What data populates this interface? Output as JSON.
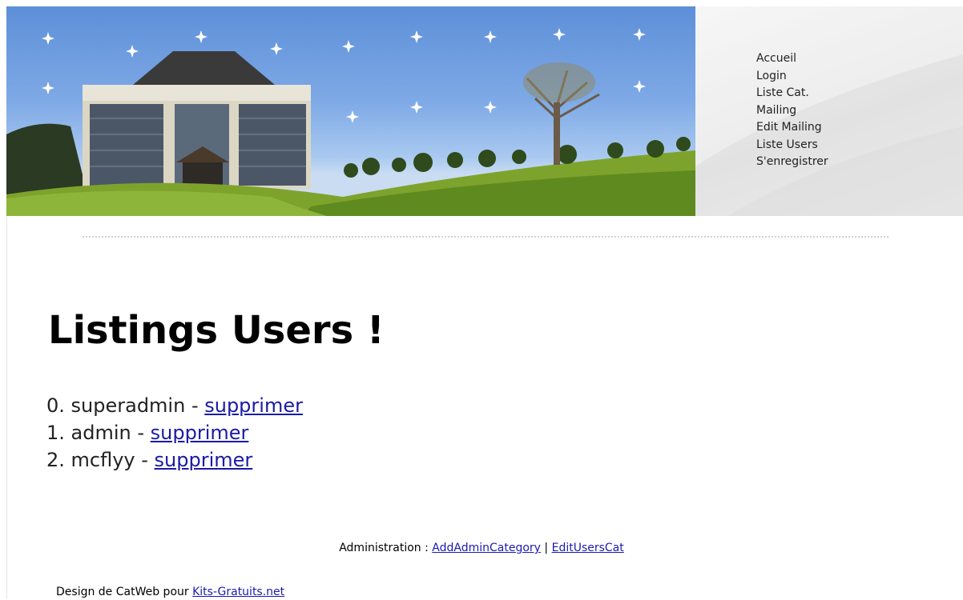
{
  "nav": {
    "items": [
      {
        "label": "Accueil"
      },
      {
        "label": "Login"
      },
      {
        "label": "Liste Cat."
      },
      {
        "label": "Mailing"
      },
      {
        "label": "Edit Mailing"
      },
      {
        "label": "Liste Users"
      },
      {
        "label": "S'enregistrer"
      }
    ]
  },
  "main": {
    "title": "Listings Users !",
    "users": [
      {
        "prefix": "0. superadmin - ",
        "action": "supprimer"
      },
      {
        "prefix": "1. admin - ",
        "action": "supprimer"
      },
      {
        "prefix": "2. mcflyy - ",
        "action": "supprimer"
      }
    ]
  },
  "admin": {
    "label": "Administration : ",
    "link1": "AddAdminCategory",
    "separator": " | ",
    "link2": "EditUsersCat"
  },
  "footer": {
    "text": "Design de CatWeb pour ",
    "link": "Kits-Gratuits.net"
  },
  "colors": {
    "link": "#1a1aa6",
    "sky": "#7ea9e6",
    "grass": "#6f9a24"
  }
}
